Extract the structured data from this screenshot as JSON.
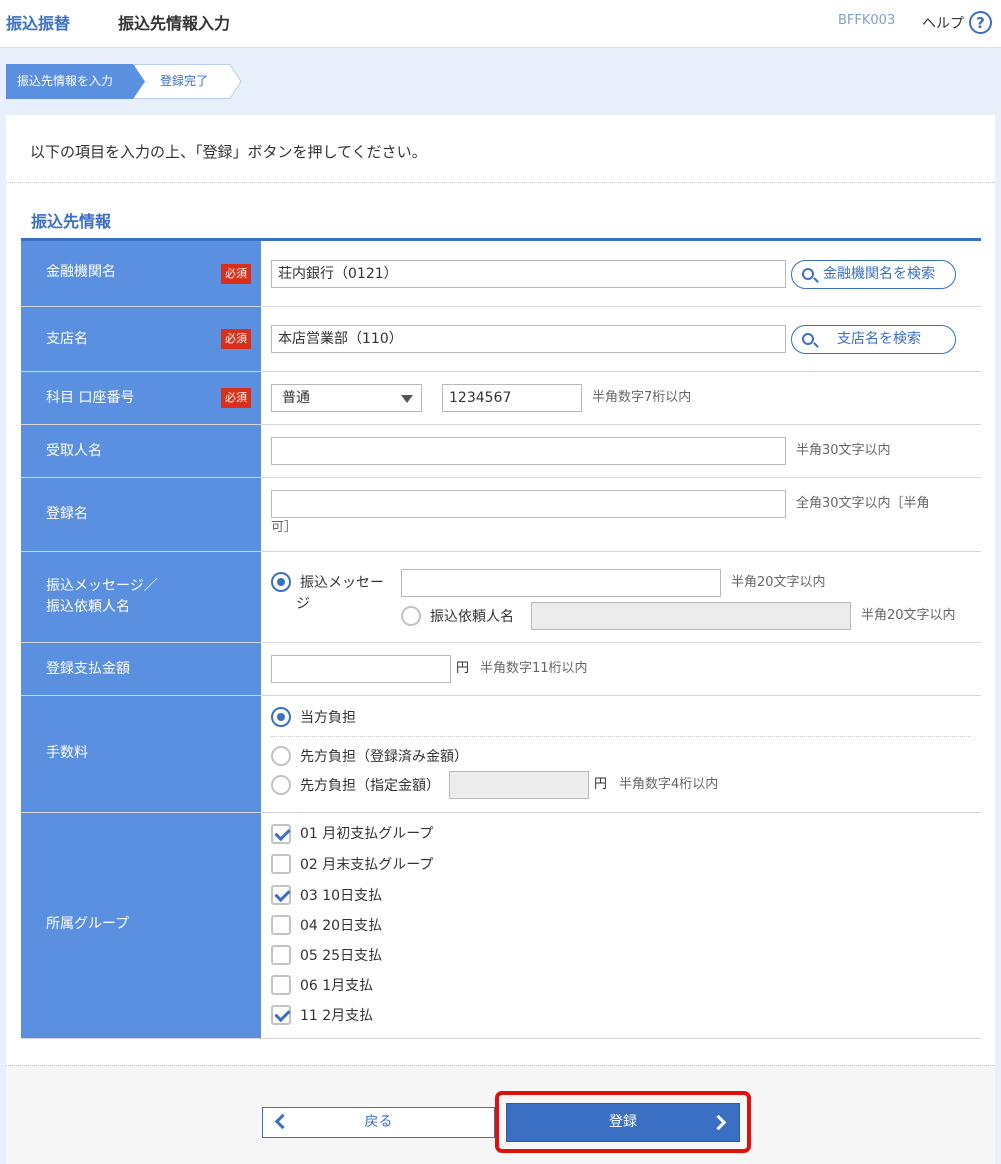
{
  "header": {
    "category": "振込振替",
    "title": "振込先情報入力",
    "screen_code": "BFFK003",
    "help_label": "ヘルプ",
    "help_icon": "?"
  },
  "steps": [
    {
      "label": "振込先情報を入力",
      "active": true
    },
    {
      "label": "登録完了",
      "active": false
    }
  ],
  "instruction": "以下の項目を入力の上、「登録」ボタンを押してください。",
  "section_title": "振込先情報",
  "required_badge": "必須",
  "form": {
    "bank": {
      "label": "金融機関名",
      "value": "荘内銀行（0121）",
      "search_button": "金融機関名を検索"
    },
    "branch": {
      "label": "支店名",
      "value": "本店営業部（110）",
      "search_button": "支店名を検索"
    },
    "account": {
      "label": "科目 口座番号",
      "type_selected": "普通",
      "number": "1234567",
      "hint": "半角数字7桁以内"
    },
    "payee": {
      "label": "受取人名",
      "value": "",
      "hint": "半角30文字以内"
    },
    "reg_name": {
      "label": "登録名",
      "value": "",
      "hint_line1": "全角30文字以内［半角",
      "hint_line2": "可］"
    },
    "message": {
      "label_line1": "振込メッセージ／",
      "label_line2": "振込依頼人名",
      "option1_line1": "振込メッセー",
      "option1_line2": "ジ",
      "option1_value": "",
      "option1_hint": "半角20文字以内",
      "option2": "振込依頼人名",
      "option2_value": "",
      "option2_hint": "半角20文字以内",
      "selected": "option1"
    },
    "amount": {
      "label": "登録支払金額",
      "value": "",
      "unit": "円",
      "hint": "半角数字11桁以内"
    },
    "fee": {
      "label": "手数料",
      "option1": "当方負担",
      "option2": "先方負担（登録済み金額）",
      "option3": "先方負担（指定金額）",
      "option3_value": "",
      "unit": "円",
      "hint": "半角数字4桁以内",
      "selected": "option1"
    },
    "groups": {
      "label": "所属グループ",
      "items": [
        {
          "label": "01 月初支払グループ",
          "checked": true
        },
        {
          "label": "02 月末支払グループ",
          "checked": false
        },
        {
          "label": "03 10日支払",
          "checked": true
        },
        {
          "label": "04 20日支払",
          "checked": false
        },
        {
          "label": "05 25日支払",
          "checked": false
        },
        {
          "label": "06 1月支払",
          "checked": false
        },
        {
          "label": "11 2月支払",
          "checked": true
        }
      ]
    }
  },
  "buttons": {
    "back": "戻る",
    "register": "登録"
  },
  "colors": {
    "accent": "#3a6fc4",
    "label_bg": "#5b8fe0",
    "required": "#d9301b",
    "highlight_frame": "#e0100b"
  }
}
